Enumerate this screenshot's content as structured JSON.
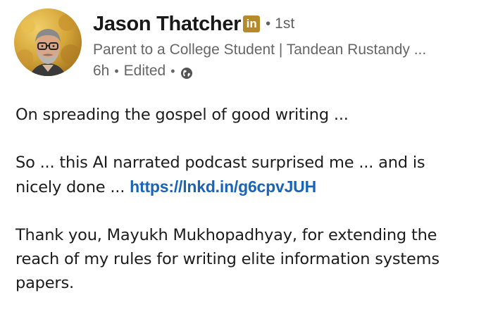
{
  "author": {
    "name": "Jason Thatcher",
    "badge": "in",
    "separator": "•",
    "degree": "1st",
    "headline": "Parent to a College Student | Tandean Rustandy ...",
    "time": "6h",
    "edited": "Edited",
    "visibility_icon": "globe-icon",
    "badge_color": "#b48a2a"
  },
  "post": {
    "line1": "On spreading the gospel of good writing ...",
    "line2a": "So ... this AI narrated podcast surprised me ... and is",
    "line2b": "nicely done ... ",
    "link": "https://lnkd.in/g6cpvJUH",
    "line3a": "Thank you, Mayukh Mukhopadhyay, for extending the",
    "line3b": "reach of my rules for writing elite information systems",
    "line3c": "papers.",
    "link_color": "#1a64b8"
  }
}
